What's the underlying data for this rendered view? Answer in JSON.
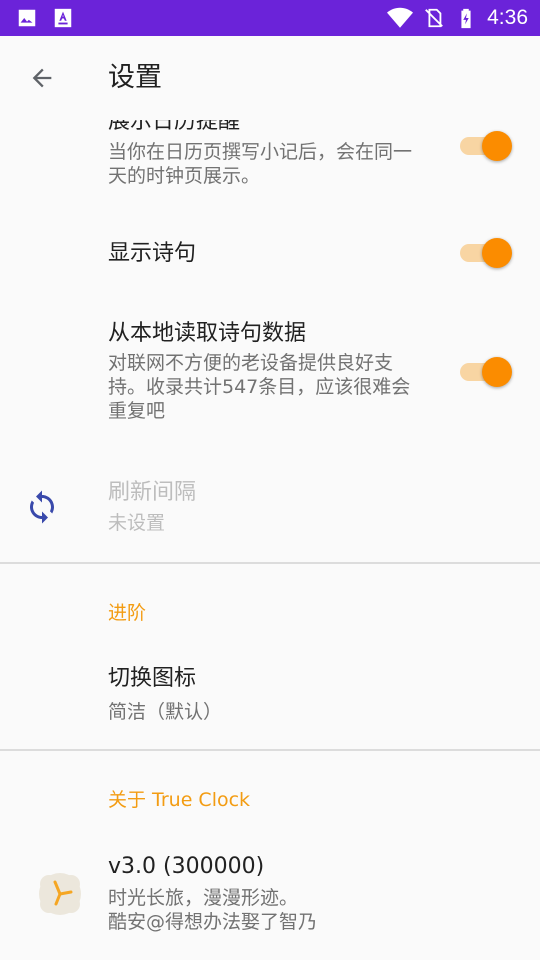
{
  "status_bar": {
    "time": "4:36",
    "left_icons": [
      "image-icon",
      "text-a-icon"
    ],
    "right_icons": [
      "wifi-icon",
      "no-sim-icon",
      "battery-charging-icon"
    ],
    "background": "#6b23d9"
  },
  "app_bar": {
    "title": "设置",
    "back_icon": "arrow-back-icon"
  },
  "prefs": {
    "calendar_reminder": {
      "title": "展示日历提醒",
      "summary": "当你在日历页撰写小记后，会在同一天的时钟页展示。",
      "enabled": true
    },
    "show_poem": {
      "title": "显示诗句",
      "enabled": true
    },
    "local_poem": {
      "title": "从本地读取诗句数据",
      "summary": "对联网不方便的老设备提供良好支持。收录共计547条目，应该很难会重复吧",
      "enabled": true
    },
    "refresh_interval": {
      "title": "刷新间隔",
      "summary": "未设置",
      "icon": "refresh-icon"
    }
  },
  "advanced": {
    "header": "进阶",
    "switch_icon": {
      "title": "切换图标",
      "summary": "简洁（默认）"
    }
  },
  "about": {
    "header": "关于 True Clock",
    "version": {
      "title": "v3.0 (300000)",
      "summary_line1": "时光长旅，漫漫形迹。",
      "summary_line2": "酷安@得想办法娶了智乃",
      "icon": "app-clock-icon"
    }
  },
  "colors": {
    "accent": "#fb8c00",
    "category": "#f39c12",
    "track": "#f8d5a3",
    "icon": "#3949ab"
  }
}
